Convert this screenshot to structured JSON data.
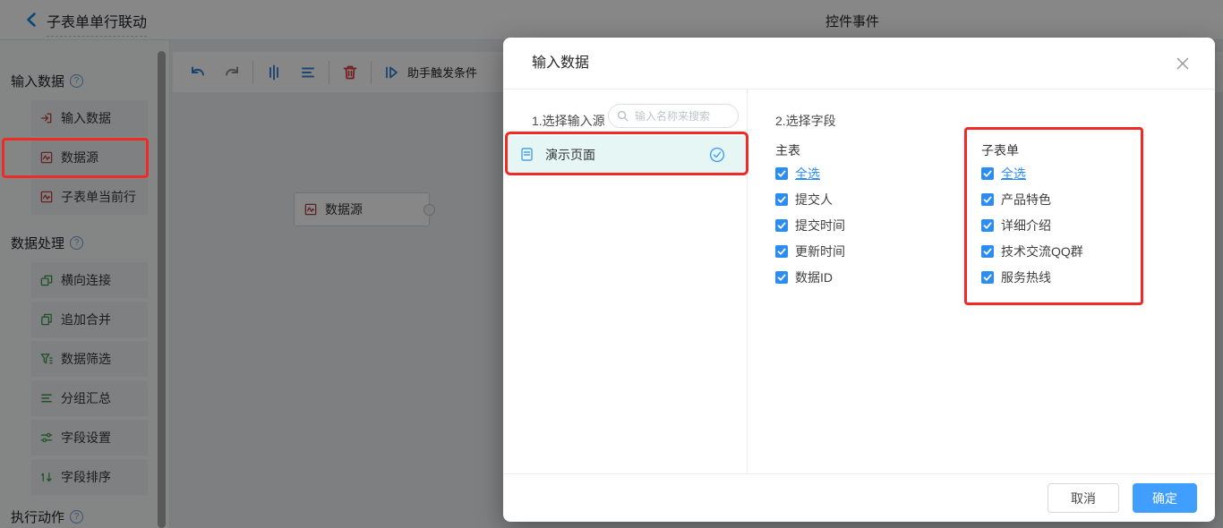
{
  "topbar": {
    "flow_title": "子表单单行联动",
    "page_title": "控件事件"
  },
  "sidebar": {
    "sections": [
      {
        "heading": "输入数据",
        "items": [
          {
            "label": "输入数据"
          },
          {
            "label": "数据源"
          },
          {
            "label": "子表单当前行"
          }
        ]
      },
      {
        "heading": "数据处理",
        "items": [
          {
            "label": "横向连接"
          },
          {
            "label": "追加合并"
          },
          {
            "label": "数据筛选"
          },
          {
            "label": "分组汇总"
          },
          {
            "label": "字段设置"
          },
          {
            "label": "字段排序"
          }
        ]
      },
      {
        "heading": "执行动作",
        "items": []
      }
    ]
  },
  "toolbar": {
    "assistant_trigger_label": "助手触发条件"
  },
  "canvas": {
    "node_label": "数据源"
  },
  "modal": {
    "title": "输入数据",
    "step1_label": "1.选择输入源",
    "search_placeholder": "输入名称来搜索",
    "source_item_label": "演示页面",
    "step2_label": "2.选择字段",
    "main_table": {
      "heading": "主表",
      "select_all_label": "全选",
      "fields": [
        "提交人",
        "提交时间",
        "更新时间",
        "数据ID"
      ]
    },
    "sub_table": {
      "heading": "子表单",
      "select_all_label": "全选",
      "fields": [
        "产品特色",
        "详细介绍",
        "技术交流QQ群",
        "服务热线"
      ]
    },
    "cancel_label": "取消",
    "confirm_label": "确定"
  },
  "colors": {
    "accent_blue": "#409eff",
    "checkbox_blue": "#2d8cf0",
    "annotation_red": "#ee2b24",
    "input_icon_red": "#c04540",
    "process_icon_green": "#3e9b4f",
    "selected_source_bg": "#e5f6f5",
    "back_arrow_blue": "#1785e5",
    "trash_red": "#d9363e"
  }
}
